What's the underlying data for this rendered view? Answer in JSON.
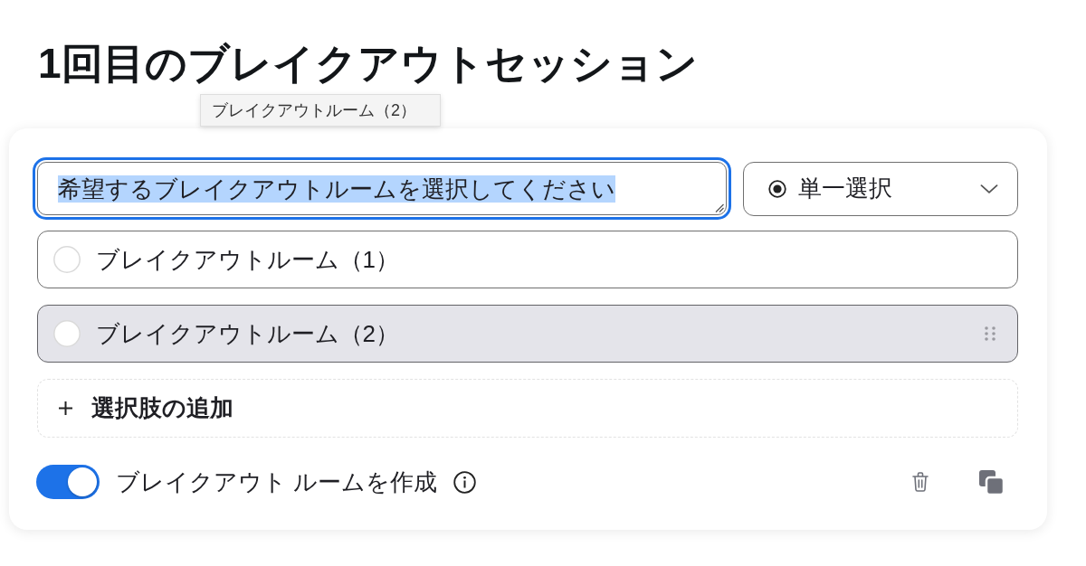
{
  "heading": "1回目のブレイクアウトセッション",
  "tooltip": {
    "text": "ブレイクアウトルーム（2）"
  },
  "question": {
    "value": "希望するブレイクアウトルームを選択してください",
    "focused": true,
    "text_selected": true
  },
  "answer_type": {
    "value": "単一選択"
  },
  "options": [
    {
      "label": "ブレイクアウトルーム（1）",
      "selected": false,
      "hovered": false
    },
    {
      "label": "ブレイクアウトルーム（2）",
      "selected": false,
      "hovered": true
    }
  ],
  "add_option": {
    "label": "選択肢の追加"
  },
  "breakout_toggle": {
    "label": "ブレイクアウト ルームを作成",
    "on": true
  }
}
